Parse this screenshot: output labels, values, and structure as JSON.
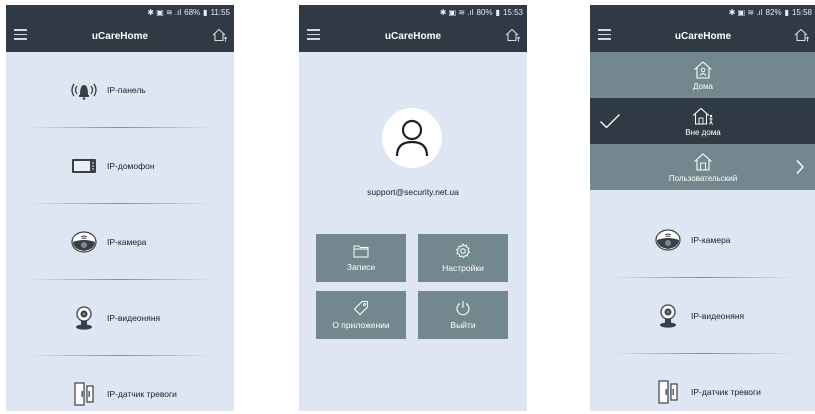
{
  "screens": [
    {
      "status": {
        "icons": "✱ ▣ ≋ .ıl",
        "battery": "68%",
        "time": "11:55"
      },
      "app_title": "uCareHome",
      "items": [
        {
          "label": "IP-панель",
          "icon": "alarm-panel-icon"
        },
        {
          "label": "IP-домофон",
          "icon": "intercom-monitor-icon"
        },
        {
          "label": "IP-камера",
          "icon": "dome-camera-icon"
        },
        {
          "label": "IP-видеоняня",
          "icon": "baby-monitor-icon"
        },
        {
          "label": "IP-датчик тревоги",
          "icon": "door-sensor-icon"
        }
      ]
    },
    {
      "status": {
        "icons": "✱ ▣ ≋ .ıl",
        "battery": "80%",
        "time": "15:53"
      },
      "app_title": "uCareHome",
      "email": "support@security.net.ua",
      "tiles": [
        {
          "label": "Записи",
          "icon": "folder-icon"
        },
        {
          "label": "Настройки",
          "icon": "gear-icon"
        },
        {
          "label": "О приложении",
          "icon": "tag-icon"
        },
        {
          "label": "Выйти",
          "icon": "power-icon"
        }
      ]
    },
    {
      "status": {
        "icons": "✱ ▣ ≋ .ıl",
        "battery": "82%",
        "time": "15:58"
      },
      "app_title": "uCareHome",
      "modes": [
        {
          "label": "Дома",
          "icon": "home-person-icon",
          "selected": false
        },
        {
          "label": "Вне дома",
          "icon": "home-away-icon",
          "selected": true
        },
        {
          "label": "Пользовательский",
          "icon": "home-custom-icon",
          "selected": false
        }
      ],
      "items": [
        {
          "label": "IP-камера",
          "icon": "dome-camera-icon"
        },
        {
          "label": "IP-видеоняня",
          "icon": "baby-monitor-icon"
        },
        {
          "label": "IP-датчик тревоги",
          "icon": "door-sensor-icon"
        }
      ]
    }
  ],
  "colors": {
    "bar": "#2f3a45",
    "bg": "#dde6f2",
    "tile": "#72888e",
    "selected": "#2f3a45"
  }
}
